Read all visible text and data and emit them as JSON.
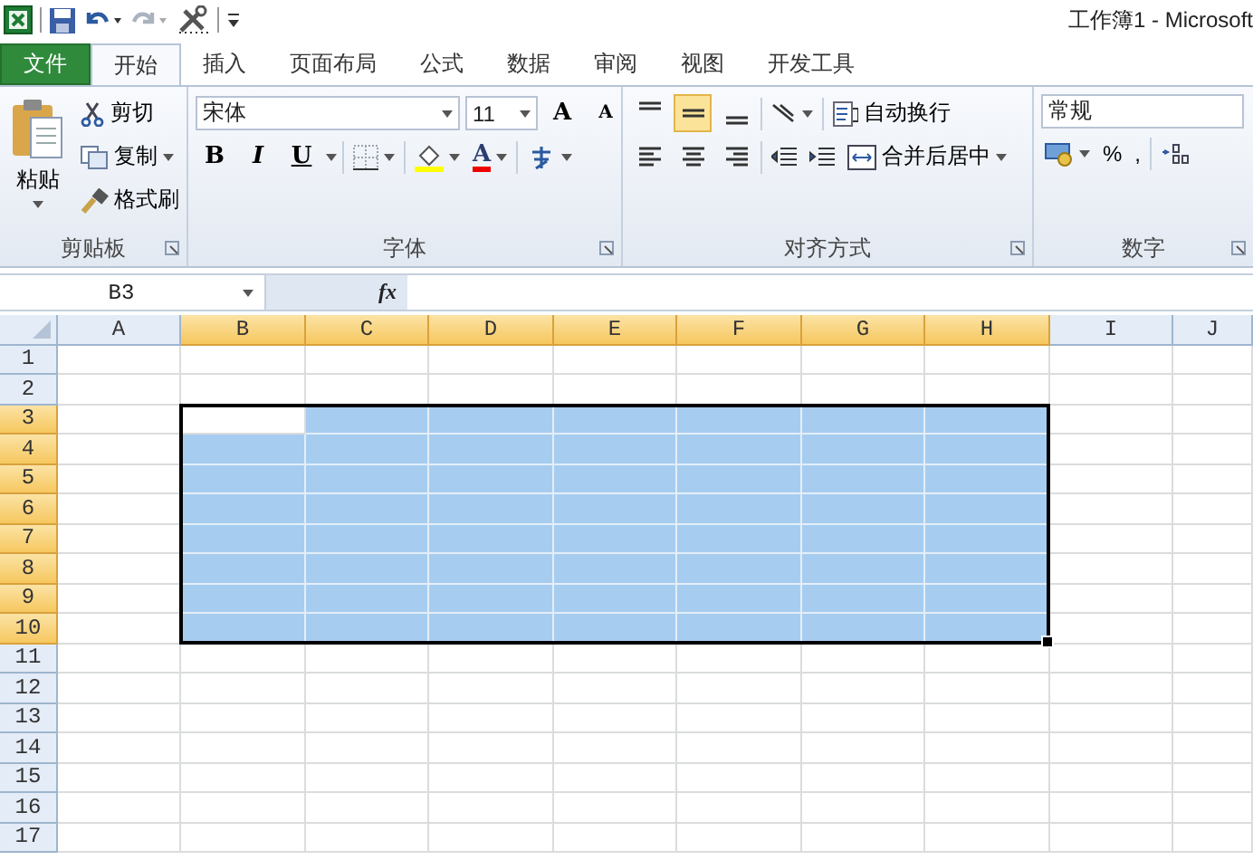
{
  "window": {
    "title": "工作簿1 - Microsoft"
  },
  "tabs": [
    {
      "label": "文件",
      "kind": "file",
      "selected": false
    },
    {
      "label": "开始",
      "kind": "tab",
      "selected": true
    },
    {
      "label": "插入",
      "kind": "tab",
      "selected": false
    },
    {
      "label": "页面布局",
      "kind": "tab",
      "selected": false
    },
    {
      "label": "公式",
      "kind": "tab",
      "selected": false
    },
    {
      "label": "数据",
      "kind": "tab",
      "selected": false
    },
    {
      "label": "审阅",
      "kind": "tab",
      "selected": false
    },
    {
      "label": "视图",
      "kind": "tab",
      "selected": false
    },
    {
      "label": "开发工具",
      "kind": "tab",
      "selected": false
    }
  ],
  "ribbon": {
    "clipboard": {
      "paste": "粘贴",
      "cut": "剪切",
      "copy": "复制",
      "format_painter": "格式刷",
      "label": "剪贴板"
    },
    "font": {
      "name": "宋体",
      "size": "11",
      "grow": "A",
      "shrink": "A",
      "bold": "B",
      "italic": "I",
      "underline": "U",
      "font_color": "A",
      "label": "字体"
    },
    "alignment": {
      "buttons": [
        {
          "kind": "top",
          "selected": false
        },
        {
          "kind": "middle",
          "selected": true
        },
        {
          "kind": "bottom",
          "selected": false
        }
      ],
      "wrap_text": "自动换行",
      "merge_center": "合并后居中",
      "label": "对齐方式"
    },
    "number": {
      "format": "常规",
      "percent": "%",
      "comma": ",",
      "label": "数字"
    }
  },
  "formula_bar": {
    "name_box": "B3",
    "fx": "fx"
  },
  "sheet": {
    "columns": [
      {
        "label": "A",
        "selected": false,
        "active": false
      },
      {
        "label": "B",
        "selected": true,
        "active": true
      },
      {
        "label": "C",
        "selected": true,
        "active": false
      },
      {
        "label": "D",
        "selected": true,
        "active": false
      },
      {
        "label": "E",
        "selected": true,
        "active": false
      },
      {
        "label": "F",
        "selected": true,
        "active": false
      },
      {
        "label": "G",
        "selected": true,
        "active": false
      },
      {
        "label": "H",
        "selected": true,
        "active": false
      },
      {
        "label": "I",
        "selected": false,
        "active": false
      },
      {
        "label": "J",
        "selected": false,
        "active": false
      }
    ],
    "rows": [
      {
        "label": "1",
        "selected": false,
        "active": false
      },
      {
        "label": "2",
        "selected": false,
        "active": false
      },
      {
        "label": "3",
        "selected": true,
        "active": true
      },
      {
        "label": "4",
        "selected": true,
        "active": false
      },
      {
        "label": "5",
        "selected": true,
        "active": false
      },
      {
        "label": "6",
        "selected": true,
        "active": false
      },
      {
        "label": "7",
        "selected": true,
        "active": false
      },
      {
        "label": "8",
        "selected": true,
        "active": false
      },
      {
        "label": "9",
        "selected": true,
        "active": false
      },
      {
        "label": "10",
        "selected": true,
        "active": false
      },
      {
        "label": "11",
        "selected": false,
        "active": false
      },
      {
        "label": "12",
        "selected": false,
        "active": false
      },
      {
        "label": "13",
        "selected": false,
        "active": false
      },
      {
        "label": "14",
        "selected": false,
        "active": false
      },
      {
        "label": "15",
        "selected": false,
        "active": false
      },
      {
        "label": "16",
        "selected": false,
        "active": false
      },
      {
        "label": "17",
        "selected": false,
        "active": false
      }
    ]
  }
}
